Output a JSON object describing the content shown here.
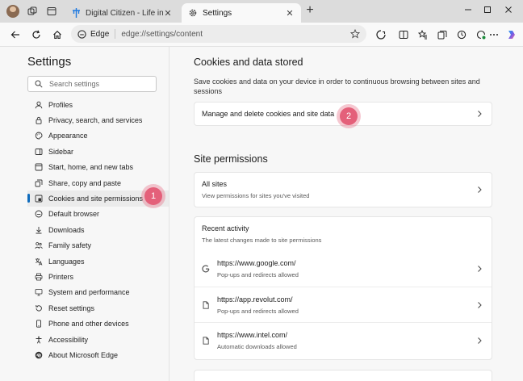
{
  "tabs": [
    {
      "label": "Digital Citizen - Life in a digital w",
      "active": false
    },
    {
      "label": "Settings",
      "active": true
    }
  ],
  "addressbar": {
    "badge": "Edge",
    "url": "edge://settings/content"
  },
  "sidebar": {
    "title": "Settings",
    "search_placeholder": "Search settings",
    "items": [
      {
        "label": "Profiles",
        "icon": "profile-icon"
      },
      {
        "label": "Privacy, search, and services",
        "icon": "lock-icon"
      },
      {
        "label": "Appearance",
        "icon": "paint-icon"
      },
      {
        "label": "Sidebar",
        "icon": "sidebar-icon"
      },
      {
        "label": "Start, home, and new tabs",
        "icon": "home-icon"
      },
      {
        "label": "Share, copy and paste",
        "icon": "share-icon"
      },
      {
        "label": "Cookies and site permissions",
        "icon": "cookie-permissions-icon",
        "selected": true
      },
      {
        "label": "Default browser",
        "icon": "browser-icon"
      },
      {
        "label": "Downloads",
        "icon": "download-icon"
      },
      {
        "label": "Family safety",
        "icon": "family-icon"
      },
      {
        "label": "Languages",
        "icon": "languages-icon"
      },
      {
        "label": "Printers",
        "icon": "printer-icon"
      },
      {
        "label": "System and performance",
        "icon": "system-icon"
      },
      {
        "label": "Reset settings",
        "icon": "reset-icon"
      },
      {
        "label": "Phone and other devices",
        "icon": "phone-icon"
      },
      {
        "label": "Accessibility",
        "icon": "accessibility-icon"
      },
      {
        "label": "About Microsoft Edge",
        "icon": "edge-logo-icon"
      }
    ]
  },
  "markers": {
    "one": "1",
    "two": "2"
  },
  "cookies_section": {
    "title": "Cookies and data stored",
    "description": "Save cookies and data on your device in order to continuous browsing between sites and sessions",
    "manage_label": "Manage and delete cookies and site data"
  },
  "permissions_section": {
    "title": "Site permissions",
    "all_sites": {
      "title": "All sites",
      "subtitle": "View permissions for sites you've visited"
    },
    "recent": {
      "title": "Recent activity",
      "subtitle": "The latest changes made to site permissions",
      "items": [
        {
          "site": "https://www.google.com/",
          "detail": "Pop-ups and redirects allowed",
          "icon": "google-icon"
        },
        {
          "site": "https://app.revolut.com/",
          "detail": "Pop-ups and redirects allowed",
          "icon": "page-icon"
        },
        {
          "site": "https://www.intel.com/",
          "detail": "Automatic downloads allowed",
          "icon": "page-icon"
        }
      ]
    }
  },
  "colors": {
    "accent": "#0f6cbd",
    "marker": "#e4607a"
  }
}
